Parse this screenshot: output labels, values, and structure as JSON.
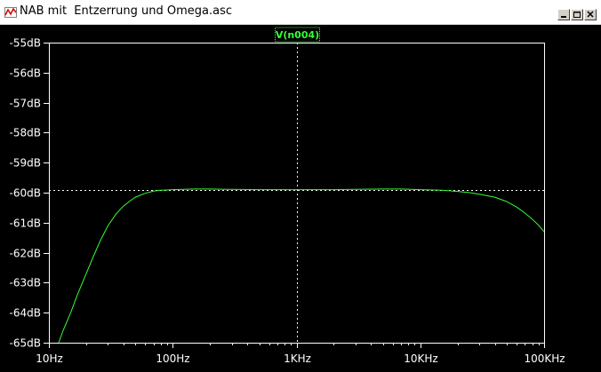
{
  "window": {
    "title": "NAB mit  Entzerrung und Omega.asc",
    "buttons": [
      "minimize-icon",
      "restore-icon",
      "close-icon"
    ]
  },
  "colors": {
    "background": "#000000",
    "trace": "#33ff33",
    "axis": "#ffffff",
    "grid": "#ffffff",
    "titlebar": "#ffffff"
  },
  "chart_data": {
    "type": "line",
    "legend": "V(n004)",
    "x_scale": "log",
    "xlim": [
      10,
      100000
    ],
    "ylim": [
      -65,
      -55
    ],
    "x_ticks": [
      {
        "value": 10,
        "label": "10Hz"
      },
      {
        "value": 100,
        "label": "100Hz"
      },
      {
        "value": 1000,
        "label": "1KHz"
      },
      {
        "value": 10000,
        "label": "10KHz"
      },
      {
        "value": 100000,
        "label": "100KHz"
      }
    ],
    "y_ticks": [
      {
        "value": -55,
        "label": "-55dB"
      },
      {
        "value": -56,
        "label": "-56dB"
      },
      {
        "value": -57,
        "label": "-57dB"
      },
      {
        "value": -58,
        "label": "-58dB"
      },
      {
        "value": -59,
        "label": "-59dB"
      },
      {
        "value": -60,
        "label": "-60dB"
      },
      {
        "value": -61,
        "label": "-61dB"
      },
      {
        "value": -62,
        "label": "-62dB"
      },
      {
        "value": -63,
        "label": "-63dB"
      },
      {
        "value": -64,
        "label": "-64dB"
      },
      {
        "value": -65,
        "label": "-65dB"
      }
    ],
    "cursor": {
      "x": 1000,
      "y": -59.9
    },
    "series": [
      {
        "name": "V(n004)",
        "x": [
          12,
          13,
          15,
          17,
          20,
          23,
          26,
          30,
          35,
          40,
          45,
          50,
          60,
          70,
          80,
          90,
          100,
          150,
          200,
          300,
          500,
          1000,
          2000,
          3000,
          5000,
          7000,
          10000,
          15000,
          20000,
          25000,
          30000,
          40000,
          50000,
          60000,
          70000,
          80000,
          90000,
          100000
        ],
        "y": [
          -65.0,
          -64.6,
          -64.0,
          -63.4,
          -62.7,
          -62.1,
          -61.6,
          -61.1,
          -60.7,
          -60.45,
          -60.28,
          -60.15,
          -60.02,
          -59.95,
          -59.92,
          -59.91,
          -59.9,
          -59.88,
          -59.88,
          -59.89,
          -59.9,
          -59.9,
          -59.9,
          -59.89,
          -59.88,
          -59.88,
          -59.9,
          -59.92,
          -59.96,
          -60.0,
          -60.05,
          -60.15,
          -60.3,
          -60.48,
          -60.68,
          -60.88,
          -61.08,
          -61.3
        ]
      }
    ]
  }
}
